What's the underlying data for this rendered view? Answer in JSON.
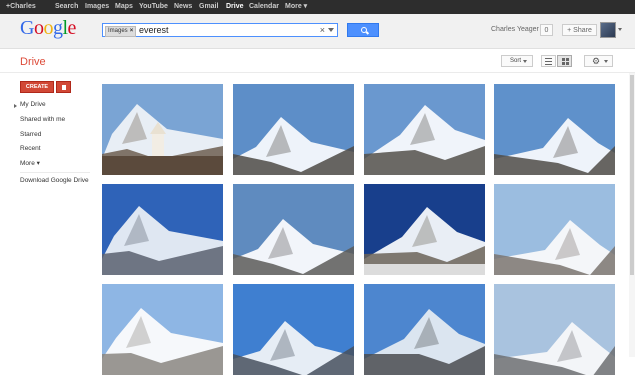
{
  "topbar": {
    "items": [
      "+Charles",
      "Search",
      "Images",
      "Maps",
      "YouTube",
      "News",
      "Gmail",
      "Drive",
      "Calendar",
      "More ▾"
    ],
    "active": "Drive"
  },
  "logo": "Google",
  "search": {
    "chip_label": "Images",
    "chip_close": "×",
    "query": "everest",
    "clear": "×"
  },
  "user": {
    "name": "Charles Yeager",
    "notifications": "0",
    "share_label": "+ Share"
  },
  "drive": {
    "title": "Drive",
    "sort_label": "Sort",
    "settings_icon": "gear-icon"
  },
  "sidebar": {
    "create_label": "CREATE",
    "items": [
      "My Drive",
      "Shared with me",
      "Starred",
      "Recent",
      "More ▾",
      "Download Google Drive"
    ]
  },
  "images": [
    {
      "icon": "everest-monastery-photo",
      "sky": "#7aa4d4",
      "snow": "#e8eef5",
      "rock": "#6d5e50"
    },
    {
      "icon": "everest-photo",
      "sky": "#5d8ec8",
      "snow": "#eef3fa",
      "rock": "#4d4a45"
    },
    {
      "icon": "everest-photo",
      "sky": "#6a98cf",
      "snow": "#f0f4fa",
      "rock": "#54504a"
    },
    {
      "icon": "everest-photo",
      "sky": "#5f91cb",
      "snow": "#eef3fa",
      "rock": "#4f4b46"
    },
    {
      "icon": "everest-photo",
      "sky": "#2f63b8",
      "snow": "#dfe7f2",
      "rock": "#5a6070"
    },
    {
      "icon": "everest-photo",
      "sky": "#5f8bbf",
      "snow": "#f2f5fa",
      "rock": "#5c5a58"
    },
    {
      "icon": "everest-photo",
      "sky": "#183f8c",
      "snow": "#e9eef5",
      "rock": "#6b6358"
    },
    {
      "icon": "everest-photo",
      "sky": "#9bbde0",
      "snow": "#f4f6f9",
      "rock": "#7a7470"
    },
    {
      "icon": "everest-photo",
      "sky": "#8eb6e4",
      "snow": "#f6f8fb",
      "rock": "#8a8680"
    },
    {
      "icon": "everest-photo",
      "sky": "#3f7fd0",
      "snow": "#e6edf5",
      "rock": "#46505e"
    },
    {
      "icon": "everest-photo",
      "sky": "#4d86cf",
      "snow": "#dbe5f0",
      "rock": "#4a4c50"
    },
    {
      "icon": "everest-photo",
      "sky": "#a9c3df",
      "snow": "#f3f5f8",
      "rock": "#6c6e72"
    }
  ]
}
